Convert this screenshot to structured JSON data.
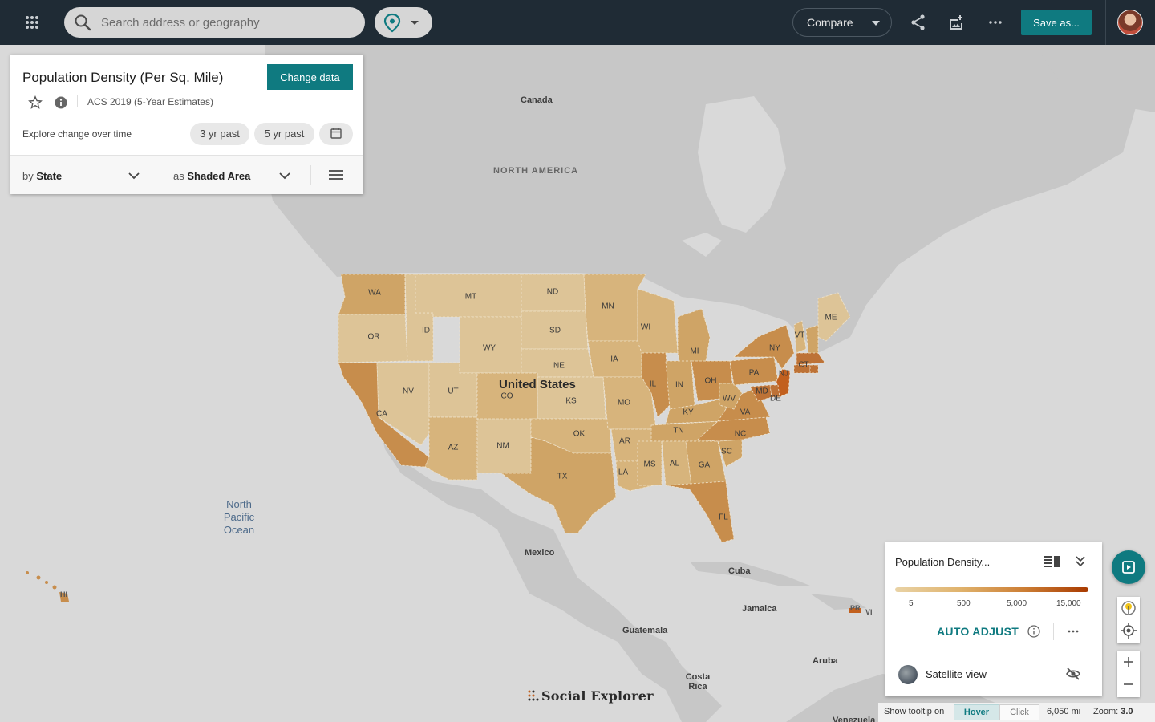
{
  "topbar": {
    "search_placeholder": "Search address or geography",
    "compare_label": "Compare",
    "save_label": "Save as...",
    "icons": [
      "apps-grid-icon",
      "search-icon",
      "location-pin-icon",
      "share-icon",
      "add-image-icon",
      "more-icon"
    ]
  },
  "panel": {
    "title": "Population Density (Per Sq. Mile)",
    "change_data_label": "Change data",
    "source": "ACS 2019 (5-Year Estimates)",
    "explore_label": "Explore change over time",
    "past_3": "3 yr past",
    "past_5": "5 yr past",
    "by_prefix": "by",
    "by_value": "State",
    "as_prefix": "as",
    "as_value": "Shaded Area"
  },
  "map": {
    "labels": {
      "canada": "Canada",
      "north_america": "NORTH AMERICA",
      "united_states": "United States",
      "mexico": "Mexico",
      "cuba": "Cuba",
      "jamaica": "Jamaica",
      "guatemala": "Guatemala",
      "costa_rica": "Costa Rica",
      "aruba": "Aruba",
      "venezuela": "Venezuela",
      "ocean": "North Pacific Ocean",
      "pr": "PR",
      "vi": "VI",
      "hi": "HI"
    },
    "colors": {
      "c1": "#ddc497",
      "c2": "#d7b47c",
      "c3": "#cfa466",
      "c4": "#c78d4c",
      "c5": "#bd7236",
      "c6": "#c2601e",
      "land": "#c7c7c7",
      "water": "#d9d9d9"
    },
    "states": [
      {
        "abbr": "WA",
        "level": 3
      },
      {
        "abbr": "OR",
        "level": 1
      },
      {
        "abbr": "CA",
        "level": 4
      },
      {
        "abbr": "ID",
        "level": 1
      },
      {
        "abbr": "NV",
        "level": 1
      },
      {
        "abbr": "MT",
        "level": 1
      },
      {
        "abbr": "WY",
        "level": 1
      },
      {
        "abbr": "UT",
        "level": 1
      },
      {
        "abbr": "AZ",
        "level": 2
      },
      {
        "abbr": "NM",
        "level": 1
      },
      {
        "abbr": "ND",
        "level": 1
      },
      {
        "abbr": "SD",
        "level": 1
      },
      {
        "abbr": "NE",
        "level": 1
      },
      {
        "abbr": "KS",
        "level": 1
      },
      {
        "abbr": "CO",
        "level": 2
      },
      {
        "abbr": "OK",
        "level": 2
      },
      {
        "abbr": "TX",
        "level": 3
      },
      {
        "abbr": "MN",
        "level": 2
      },
      {
        "abbr": "IA",
        "level": 2
      },
      {
        "abbr": "MO",
        "level": 2
      },
      {
        "abbr": "AR",
        "level": 2
      },
      {
        "abbr": "LA",
        "level": 2
      },
      {
        "abbr": "WI",
        "level": 2
      },
      {
        "abbr": "IL",
        "level": 4
      },
      {
        "abbr": "MI",
        "level": 3
      },
      {
        "abbr": "IN",
        "level": 3
      },
      {
        "abbr": "OH",
        "level": 4
      },
      {
        "abbr": "KY",
        "level": 3
      },
      {
        "abbr": "TN",
        "level": 3
      },
      {
        "abbr": "MS",
        "level": 2
      },
      {
        "abbr": "AL",
        "level": 2
      },
      {
        "abbr": "GA",
        "level": 3
      },
      {
        "abbr": "FL",
        "level": 4
      },
      {
        "abbr": "SC",
        "level": 3
      },
      {
        "abbr": "NC",
        "level": 4
      },
      {
        "abbr": "VA",
        "level": 4
      },
      {
        "abbr": "WV",
        "level": 3
      },
      {
        "abbr": "PA",
        "level": 4
      },
      {
        "abbr": "NY",
        "level": 4
      },
      {
        "abbr": "VT",
        "level": 2
      },
      {
        "abbr": "ME",
        "level": 1
      },
      {
        "abbr": "NH",
        "level": 3
      },
      {
        "abbr": "MA",
        "level": 5
      },
      {
        "abbr": "CT",
        "level": 5
      },
      {
        "abbr": "RI",
        "level": 5
      },
      {
        "abbr": "NJ",
        "level": 6
      },
      {
        "abbr": "DE",
        "level": 5
      },
      {
        "abbr": "MD",
        "level": 5
      }
    ]
  },
  "legend": {
    "title": "Population Density...",
    "ticks": [
      "5",
      "500",
      "5,000",
      "15,000"
    ],
    "auto_adjust_label": "AUTO ADJUST",
    "satellite_label": "Satellite view"
  },
  "bottombar": {
    "tooltip_label": "Show tooltip on",
    "hover_label": "Hover",
    "click_label": "Click",
    "scale": "6,050 mi",
    "zoom_label": "Zoom:",
    "zoom_value": "3.0"
  },
  "logo": {
    "text": "Social Explorer"
  }
}
